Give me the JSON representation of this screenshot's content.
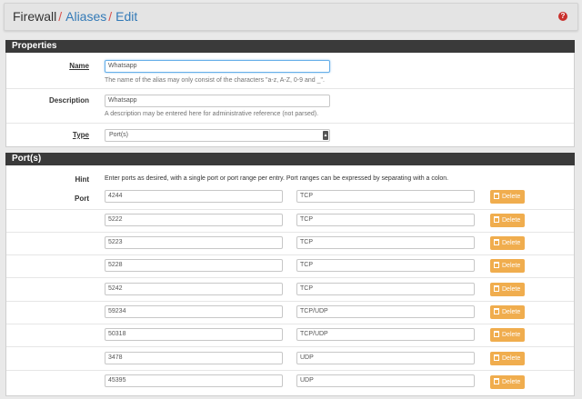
{
  "breadcrumb": {
    "first": "Firewall",
    "separator": "/",
    "second": "Aliases",
    "third": "Edit"
  },
  "properties": {
    "heading": "Properties",
    "name_label": "Name",
    "name_value": "Whatsapp",
    "name_help": "The name of the alias may only consist of the characters \"a-z, A-Z, 0-9 and _\".",
    "description_label": "Description",
    "description_value": "Whatsapp",
    "description_help": "A description may be entered here for administrative reference (not parsed).",
    "type_label": "Type",
    "type_value": "Port(s)"
  },
  "ports": {
    "heading": "Port(s)",
    "hint_label": "Hint",
    "hint_text": "Enter ports as desired, with a single port or port range per entry. Port ranges can be expressed by separating with a colon.",
    "port_label": "Port",
    "delete_label": "Delete",
    "rows": [
      {
        "port": "4244",
        "desc": "TCP"
      },
      {
        "port": "5222",
        "desc": "TCP"
      },
      {
        "port": "5223",
        "desc": "TCP"
      },
      {
        "port": "5228",
        "desc": "TCP"
      },
      {
        "port": "5242",
        "desc": "TCP"
      },
      {
        "port": "59234",
        "desc": "TCP/UDP"
      },
      {
        "port": "50318",
        "desc": "TCP/UDP"
      },
      {
        "port": "3478",
        "desc": "UDP"
      },
      {
        "port": "45395",
        "desc": "UDP"
      }
    ]
  },
  "colors": {
    "header_bar": "#3a3a3a",
    "link": "#337ab7",
    "separator": "#d9534f",
    "delete_button": "#f0ad4e"
  }
}
